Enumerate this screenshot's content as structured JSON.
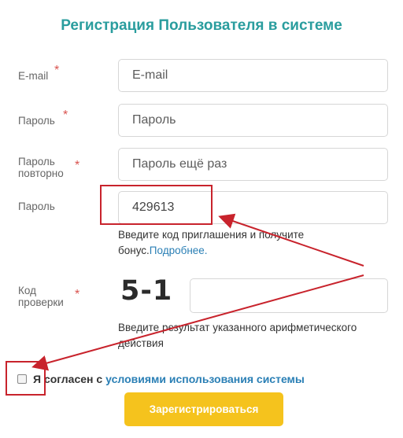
{
  "form": {
    "title": "Регистрация Пользователя в системе",
    "email": {
      "label": "E-mail",
      "placeholder": "E-mail",
      "value": ""
    },
    "password": {
      "label": "Пароль",
      "placeholder": "Пароль",
      "value": ""
    },
    "password_repeat": {
      "label": "Пароль повторно",
      "placeholder": "Пароль ещё раз",
      "value": ""
    },
    "invite": {
      "label": "Пароль",
      "value": "429613",
      "hint": "Введите код приглашения и получите бонус.",
      "hint_link": "Подробнее."
    },
    "captcha": {
      "label": "Код проверки",
      "image_text": "5-1",
      "value": "",
      "hint": "Введите результат указанного арифметического действия"
    },
    "agree": {
      "text": "Я согласен с",
      "link": "условиями использования системы",
      "checked": false
    },
    "submit_label": "Зарегистрироваться",
    "required_mark": "*"
  },
  "colors": {
    "title": "#2a9d9e",
    "link": "#2a7fb5",
    "button": "#f5c31d",
    "required": "#d9534f",
    "annotation": "#c8232c"
  }
}
